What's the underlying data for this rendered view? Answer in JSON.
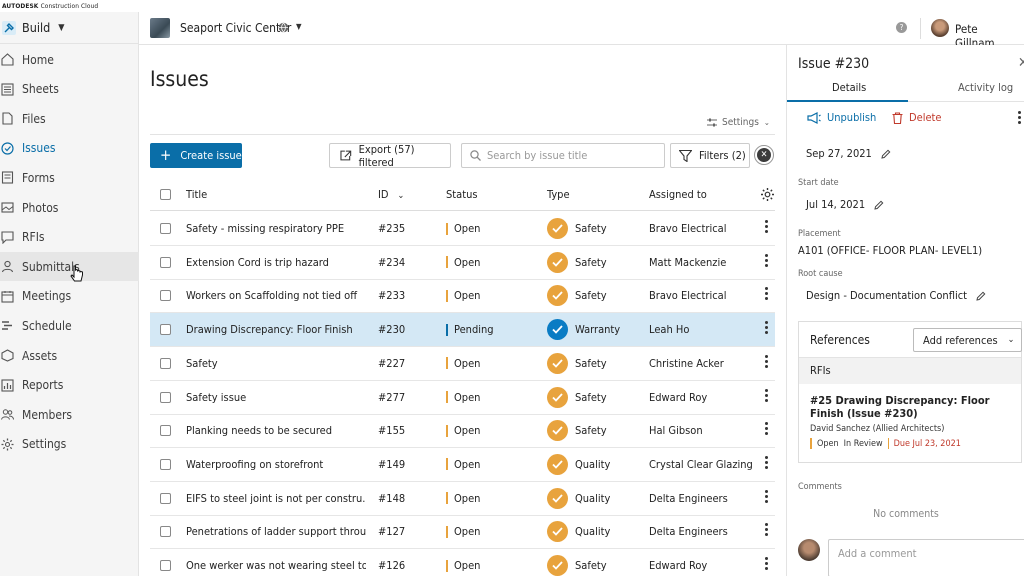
{
  "brand": {
    "logo_text": "AUTODESK",
    "product": "Construction Cloud"
  },
  "sidebar": {
    "module": "Build",
    "items": [
      {
        "label": "Home",
        "icon": "home-icon"
      },
      {
        "label": "Sheets",
        "icon": "sheets-icon"
      },
      {
        "label": "Files",
        "icon": "files-icon"
      },
      {
        "label": "Issues",
        "icon": "issues-icon",
        "active": true
      },
      {
        "label": "Forms",
        "icon": "forms-icon"
      },
      {
        "label": "Photos",
        "icon": "photos-icon"
      },
      {
        "label": "RFIs",
        "icon": "rfis-icon"
      },
      {
        "label": "Submittals",
        "icon": "submittals-icon",
        "hover": true
      },
      {
        "label": "Meetings",
        "icon": "meetings-icon"
      },
      {
        "label": "Schedule",
        "icon": "schedule-icon"
      },
      {
        "label": "Assets",
        "icon": "assets-icon"
      },
      {
        "label": "Reports",
        "icon": "reports-icon"
      },
      {
        "label": "Members",
        "icon": "members-icon"
      },
      {
        "label": "Settings",
        "icon": "settings-icon"
      }
    ]
  },
  "header": {
    "project": "Seaport Civic Center",
    "user": "Pete Gillnam..."
  },
  "page": {
    "title": "Issues",
    "settings_label": "Settings",
    "create_label": "Create issue",
    "export_label": "Export (57) filtered",
    "search_placeholder": "Search by issue title",
    "filters_label": "Filters (2)"
  },
  "table": {
    "columns": {
      "title": "Title",
      "id": "ID",
      "status": "Status",
      "type": "Type",
      "assigned": "Assigned to"
    },
    "rows": [
      {
        "title": "Safety - missing respiratory PPE",
        "id": "#235",
        "status": "Open",
        "type": "Safety",
        "assigned": "Bravo Electrical"
      },
      {
        "title": "Extension Cord is trip hazard",
        "id": "#234",
        "status": "Open",
        "type": "Safety",
        "assigned": "Matt Mackenzie"
      },
      {
        "title": "Workers on Scaffolding not tied off",
        "id": "#233",
        "status": "Open",
        "type": "Safety",
        "assigned": "Bravo Electrical"
      },
      {
        "title": "Drawing Discrepancy: Floor Finish",
        "id": "#230",
        "status": "Pending",
        "type": "Warranty",
        "assigned": "Leah Ho",
        "selected": true
      },
      {
        "title": "Safety",
        "id": "#227",
        "status": "Open",
        "type": "Safety",
        "assigned": "Christine Acker"
      },
      {
        "title": "Safety issue",
        "id": "#277",
        "status": "Open",
        "type": "Safety",
        "assigned": "Edward Roy"
      },
      {
        "title": "Planking needs to be secured",
        "id": "#155",
        "status": "Open",
        "type": "Safety",
        "assigned": "Hal Gibson"
      },
      {
        "title": "Waterproofing on storefront",
        "id": "#149",
        "status": "Open",
        "type": "Quality",
        "assigned": "Crystal Clear Glazing"
      },
      {
        "title": "EIFS to steel joint is not per constru...",
        "id": "#148",
        "status": "Open",
        "type": "Quality",
        "assigned": "Delta Engineers"
      },
      {
        "title": "Penetrations of ladder support throu...",
        "id": "#127",
        "status": "Open",
        "type": "Quality",
        "assigned": "Delta Engineers"
      },
      {
        "title": "One werker was not wearing steel to...",
        "id": "#126",
        "status": "Open",
        "type": "Safety",
        "assigned": "Edward Roy"
      }
    ]
  },
  "panel": {
    "title": "Issue #230",
    "tabs": {
      "details": "Details",
      "activity": "Activity log"
    },
    "unpublish_label": "Unpublish",
    "delete_label": "Delete",
    "due_date": "Sep 27, 2021",
    "start_date_label": "Start date",
    "start_date": "Jul 14, 2021",
    "placement_label": "Placement",
    "placement": "A101 (OFFICE- FLOOR PLAN- LEVEL1)",
    "root_cause_label": "Root cause",
    "root_cause": "Design - Documentation Conflict",
    "references": {
      "label": "References",
      "add_label": "Add references",
      "group": "RFIs",
      "item_title": "#25 Drawing Discrepancy: Floor Finish (Issue #230)",
      "item_by": "David Sanchez (Allied Architects)",
      "item_status": "Open",
      "item_state": "In Review",
      "item_due": "Due Jul 23, 2021"
    },
    "comments_label": "Comments",
    "no_comments": "No comments",
    "comment_placeholder": "Add a comment"
  },
  "colors": {
    "accent": "#0a6ea8",
    "safety": "#e8a33d",
    "warranty": "#0a7cc4",
    "delete": "#c0392b",
    "selected_row": "#d4e8f5"
  }
}
